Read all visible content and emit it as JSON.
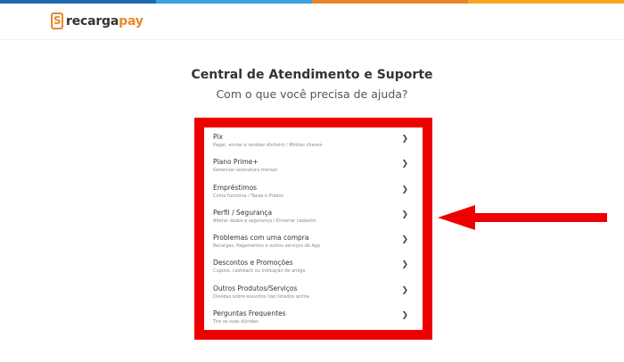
{
  "topbar_colors": [
    "#1f6ab0",
    "#3aa3e3",
    "#e8882a",
    "#f5a623"
  ],
  "brand": {
    "mark": "S",
    "name_dark": "recarga",
    "name_accent": "pay",
    "accent_color": "#e8882a"
  },
  "page": {
    "title": "Central de Atendimento e Suporte",
    "subtitle": "Com o que você precisa de ajuda?"
  },
  "highlight_color": "#ee0000",
  "menu": {
    "items": [
      {
        "label": "Pix",
        "desc": "Pagar, enviar e receber dinheiro / Minhas chaves"
      },
      {
        "label": "Plano Prime+",
        "desc": "Gerenciar assinatura mensal"
      },
      {
        "label": "Empréstimos",
        "desc": "Como funciona / Taxas e Prazos"
      },
      {
        "label": "Perfil / Segurança",
        "desc": "Alterar dados e segurança / Encerrar cadastro"
      },
      {
        "label": "Problemas com uma compra",
        "desc": "Recargas, Pagamentos e outros serviços do App"
      },
      {
        "label": "Descontos e Promoções",
        "desc": "Cupons, cashback ou indicação de amigo"
      },
      {
        "label": "Outros Produtos/Serviços",
        "desc": "Dúvidas sobre assuntos não listados acima"
      },
      {
        "label": "Perguntas Frequentes",
        "desc": "Tire as suas dúvidas"
      }
    ],
    "chevron_icon": "chevron-right-icon"
  }
}
